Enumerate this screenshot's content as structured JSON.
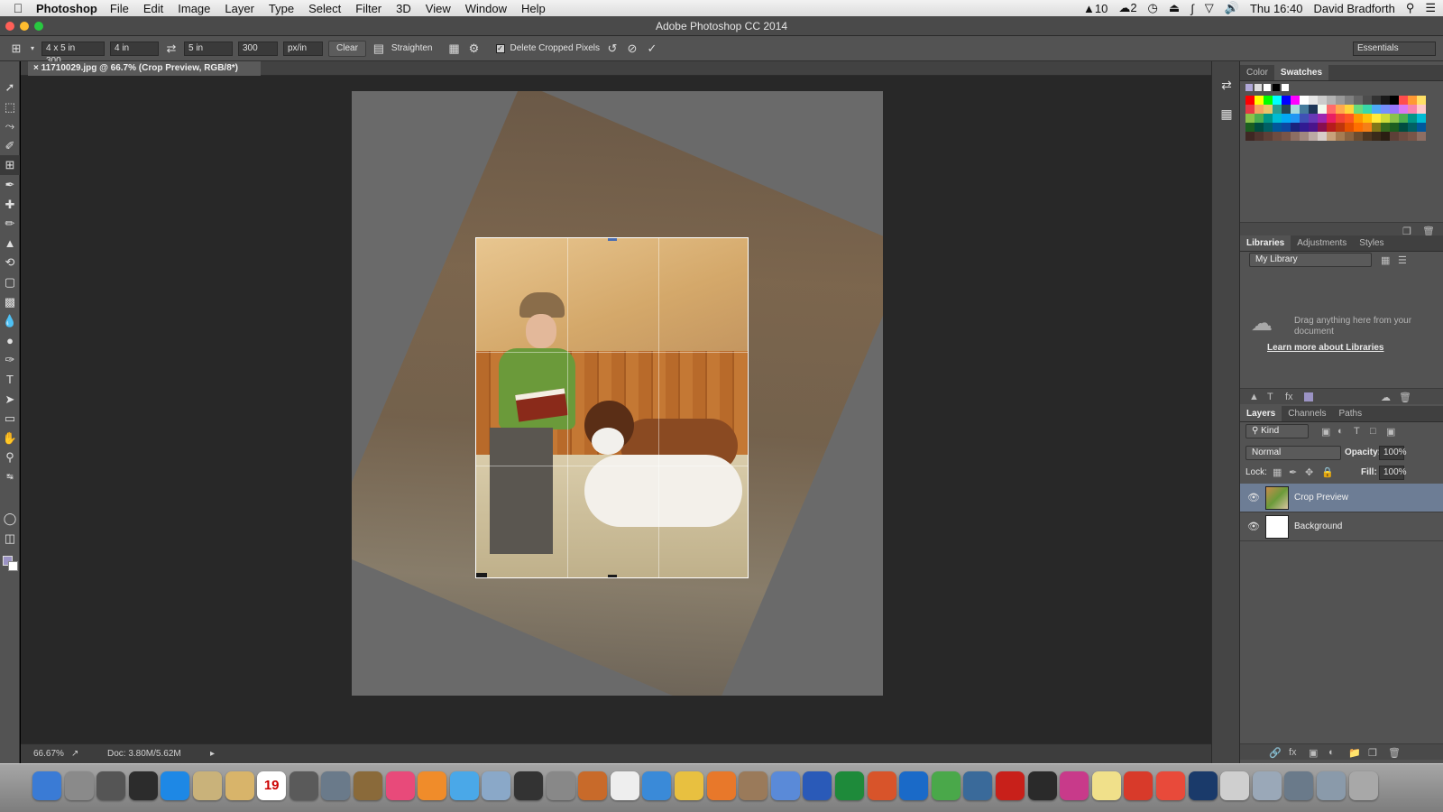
{
  "menubar": {
    "app": "Photoshop",
    "items": [
      "File",
      "Edit",
      "Image",
      "Layer",
      "Type",
      "Select",
      "Filter",
      "3D",
      "View",
      "Window",
      "Help"
    ],
    "status_left": "10",
    "status_cc": "2",
    "clock": "Thu 16:40",
    "user": "David Bradforth"
  },
  "window": {
    "title": "Adobe Photoshop CC 2014"
  },
  "options": {
    "preset": "4 x 5 in 300...",
    "width": "4 in",
    "height": "5 in",
    "resolution": "300",
    "units": "px/in",
    "clear": "Clear",
    "straighten": "Straighten",
    "delete_cropped": "Delete Cropped Pixels",
    "workspace": "Essentials"
  },
  "document": {
    "tab_label": "11710029.jpg @ 66.7% (Crop Preview, RGB/8*)"
  },
  "status": {
    "zoom": "66.67%",
    "doc": "Doc: 3.80M/5.62M"
  },
  "panels": {
    "color_tabs": [
      "Color",
      "Swatches"
    ],
    "library_tabs": [
      "Libraries",
      "Adjustments",
      "Styles"
    ],
    "library_select": "My Library",
    "library_message": "Drag anything here from your document",
    "library_link": "Learn more about Libraries",
    "layer_tabs": [
      "Layers",
      "Channels",
      "Paths"
    ],
    "kind": "Kind",
    "blend_mode": "Normal",
    "opacity_label": "Opacity:",
    "opacity": "100%",
    "lock_label": "Lock:",
    "fill_label": "Fill:",
    "fill": "100%",
    "layers": [
      "Crop Preview",
      "Background"
    ]
  },
  "colors": {
    "accent_layer_selected": "#6d7d95",
    "swatch_rows": [
      [
        "#ff0000",
        "#ffff00",
        "#00ff00",
        "#00ffff",
        "#0000ff",
        "#ff00ff",
        "#ffffff",
        "#e6e6e6",
        "#cccccc",
        "#b3b3b3",
        "#999999",
        "#808080",
        "#666666",
        "#4d4d4d",
        "#333333",
        "#1a1a1a",
        "#000000",
        "#ff4d4d",
        "#ff9933",
        "#ffe066"
      ],
      [
        "#e63946",
        "#f4a261",
        "#e9c46a",
        "#2a9d8f",
        "#264653",
        "#a8dadc",
        "#457b9d",
        "#1d3557",
        "#f1faee",
        "#ff6b6b",
        "#ffa94d",
        "#ffd43b",
        "#69db7c",
        "#38d9a9",
        "#4dabf7",
        "#748ffc",
        "#9775fa",
        "#da77f2",
        "#f783ac",
        "#ffc9c9"
      ],
      [
        "#8bc34a",
        "#4caf50",
        "#009688",
        "#00bcd4",
        "#03a9f4",
        "#2196f3",
        "#3f51b5",
        "#673ab7",
        "#9c27b0",
        "#e91e63",
        "#f44336",
        "#ff5722",
        "#ff9800",
        "#ffc107",
        "#ffeb3b",
        "#cddc39",
        "#8bc34a",
        "#4caf50",
        "#009688",
        "#00bcd4"
      ],
      [
        "#1b5e20",
        "#004d40",
        "#006064",
        "#01579b",
        "#0d47a1",
        "#1a237e",
        "#311b92",
        "#4a148c",
        "#880e4f",
        "#b71c1c",
        "#bf360c",
        "#e65100",
        "#ff6f00",
        "#f57f17",
        "#827717",
        "#33691e",
        "#1b5e20",
        "#004d40",
        "#006064",
        "#01579b"
      ],
      [
        "#3e2723",
        "#4e342e",
        "#5d4037",
        "#6d4c41",
        "#795548",
        "#8d6e63",
        "#a1887f",
        "#bcaaa4",
        "#d7ccc8",
        "#c8a27a",
        "#a67c52",
        "#8a6340",
        "#6b4c30",
        "#4e3620",
        "#3a2a1a",
        "#2a1e12",
        "#5d4037",
        "#6d4c41",
        "#795548",
        "#8d6e63"
      ]
    ]
  },
  "dock": {
    "apps": [
      "Finder",
      "Launchpad",
      "Calculator",
      "Dashboard",
      "App Store",
      "Preview",
      "Contacts",
      "Calendar",
      "Photo Booth",
      "Image Capture",
      "iMovie",
      "iTunes",
      "iBooks",
      "Messages",
      "Photo",
      "Time Machine",
      "System Preferences",
      "GarageBand",
      "Numbers",
      "Safari",
      "Chrome",
      "Firefox",
      "iPhoto",
      "Keynote",
      "Word",
      "Excel",
      "PowerPoint",
      "Outlook",
      "Maps",
      "Network",
      "Acrobat",
      "Lightroom",
      "InDesign",
      "Notes",
      "Acrobat Reader",
      "PDF",
      "Photoshop",
      "Documents",
      "Downloads",
      "Screenshots",
      "Display",
      "Trash"
    ],
    "calendar_day": "19"
  }
}
